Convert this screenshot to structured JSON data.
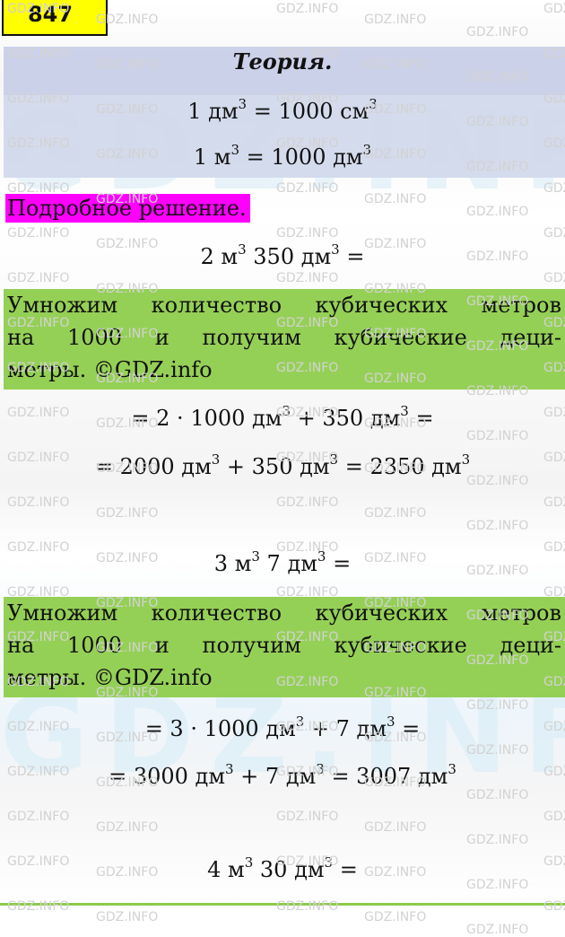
{
  "task": {
    "number": "847"
  },
  "theory": {
    "title": "Теория.",
    "formulas": [
      {
        "lhs": "1 дм",
        "lhs_exp": "3",
        "rhs": " = 1000 см",
        "rhs_exp": "3"
      },
      {
        "lhs": "1 м",
        "lhs_exp": "3",
        "rhs": " = 1000 дм",
        "rhs_exp": "3"
      }
    ]
  },
  "solution_label": "Подробное решение.",
  "explanation": {
    "lines": [
      "Умножим количество кубических метров",
      "на 1000 и получим кубические деци-",
      "метры. ©GDZ.info"
    ]
  },
  "problems": [
    {
      "expression": [
        "2 м",
        "3",
        " 350 дм",
        "3",
        " ="
      ],
      "steps": [
        [
          "= 2 · 1000 дм",
          "3",
          " + 350 дм",
          "3",
          " ="
        ],
        [
          "= 2000 дм",
          "3",
          " + 350 дм",
          "3",
          " = 2350 дм",
          "3"
        ]
      ]
    },
    {
      "expression": [
        "3 м",
        "3",
        " 7 дм",
        "3",
        " ="
      ],
      "steps": [
        [
          "= 3 · 1000 дм",
          "3",
          " + 7 дм",
          "3",
          " ="
        ],
        [
          "= 3000 дм",
          "3",
          " + 7 дм",
          "3",
          " = 3007 дм",
          "3"
        ]
      ]
    },
    {
      "expression": [
        "4 м",
        "3",
        " 30 дм",
        "3",
        " ="
      ]
    }
  ],
  "watermark": {
    "small": "GDZ.INFO",
    "large": "GDZ.INFO"
  },
  "colors": {
    "badge": "#ffff00",
    "theory_bg": "#c4cae8",
    "solution_label_bg": "#ff00ff",
    "explanation_bg": "#8ccc48"
  }
}
